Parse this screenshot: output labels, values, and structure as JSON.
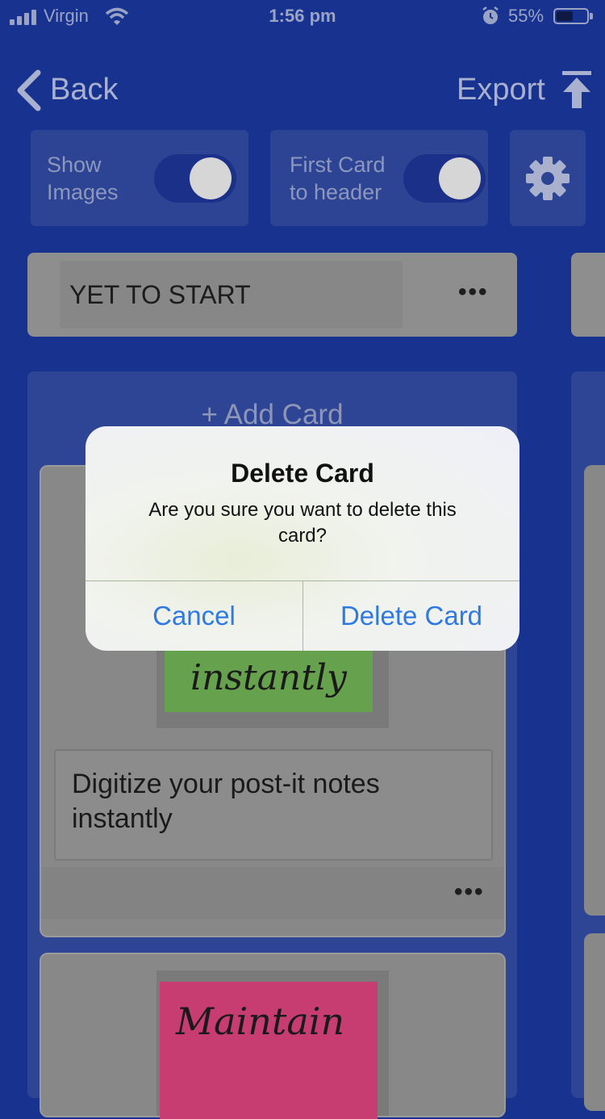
{
  "status_bar": {
    "carrier": "Virgin",
    "time": "1:56 pm",
    "battery_percent": "55%",
    "battery_level": 0.55
  },
  "nav": {
    "back_label": "Back",
    "export_label": "Export"
  },
  "toggles": {
    "show_images": {
      "label_line1": "Show",
      "label_line2": "Images",
      "on": true
    },
    "first_card_header": {
      "label_line1": "First Card",
      "label_line2": "to header",
      "on": true
    }
  },
  "icons": {
    "settings": "gear-icon",
    "export": "upload-arrow-icon",
    "back": "chevron-left-icon"
  },
  "column": {
    "title": "YET TO START",
    "menu_label": "•••",
    "add_card_label": "+ Add Card",
    "cards": [
      {
        "note_text": "instantly",
        "note_color": "#66a14e",
        "text": "Digitize your post-it notes instantly",
        "menu_label": "•••"
      },
      {
        "note_text": "Maintain",
        "note_color": "#c73d72"
      }
    ]
  },
  "alert": {
    "title": "Delete Card",
    "message": "Are you sure you want to delete this card?",
    "cancel_label": "Cancel",
    "confirm_label": "Delete Card"
  },
  "colors": {
    "background": "#183290",
    "accent_blue": "#2e79e2"
  }
}
